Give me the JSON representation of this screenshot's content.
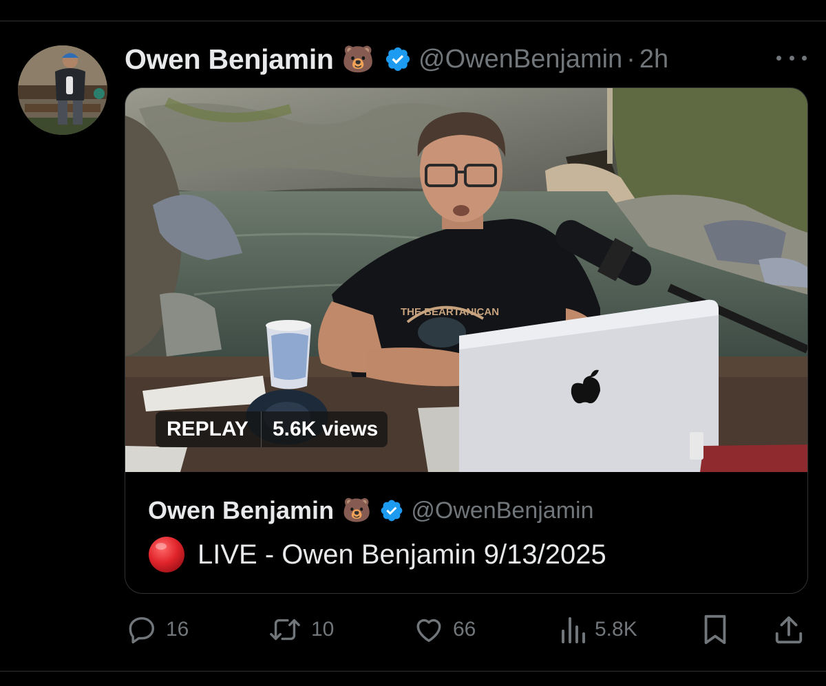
{
  "post": {
    "display_name": "Owen Benjamin",
    "emoji": "🐻",
    "handle": "@OwenBenjamin",
    "separator": "·",
    "time": "2h"
  },
  "media": {
    "replay_label": "REPLAY",
    "views": "5.6K views",
    "shirt_text": "THE BEARTANICAN"
  },
  "quote": {
    "display_name": "Owen Benjamin",
    "emoji": "🐻",
    "handle": "@OwenBenjamin",
    "live_emoji": "🔴",
    "text": "LIVE - Owen Benjamin 9/13/2025"
  },
  "actions": {
    "replies": "16",
    "reposts": "10",
    "likes": "66",
    "views": "5.8K"
  },
  "colors": {
    "background": "#000000",
    "verified": "#1d9bf0",
    "muted": "#71767b",
    "text": "#e7e9ea",
    "live_red": "#e0242b"
  },
  "icons": [
    "reply-icon",
    "repost-icon",
    "like-icon",
    "views-icon",
    "bookmark-icon",
    "share-icon",
    "verified-icon",
    "more-icon"
  ]
}
